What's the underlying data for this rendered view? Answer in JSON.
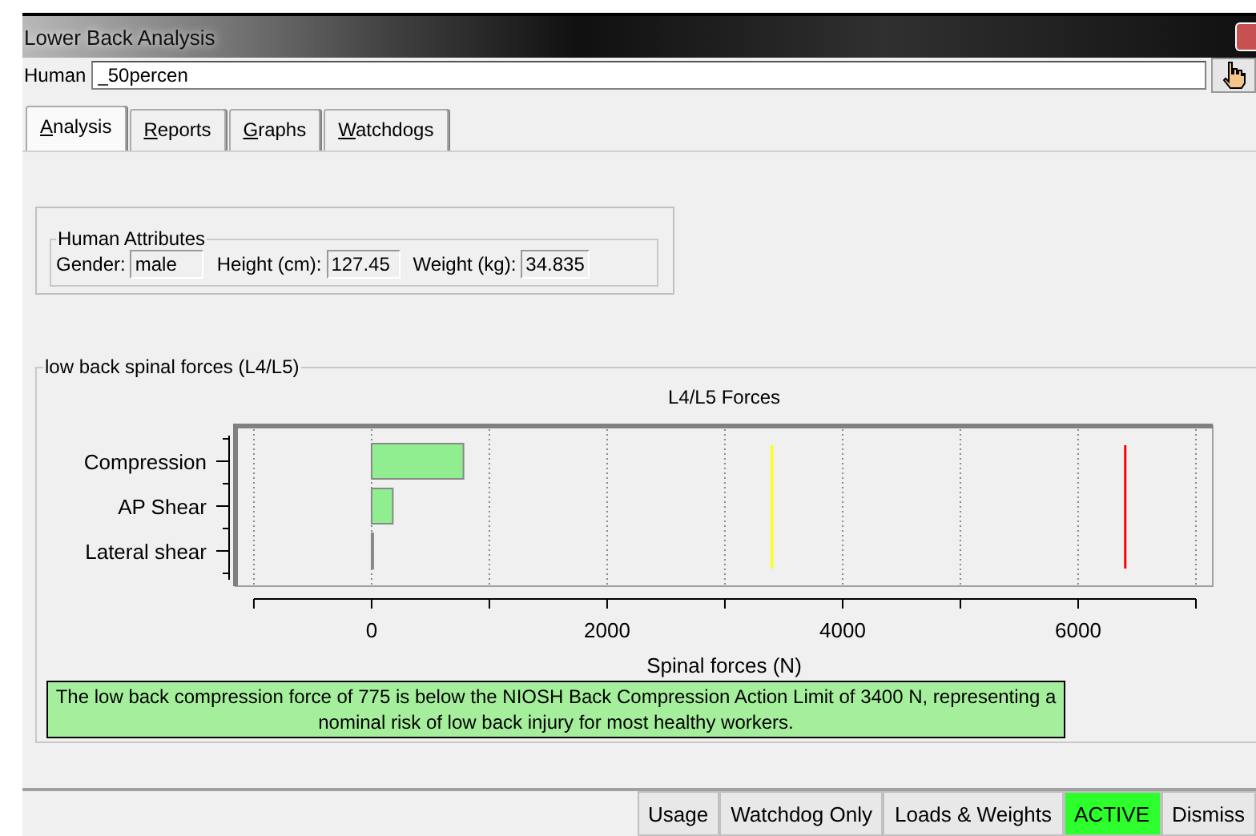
{
  "window": {
    "title": "Lower Back Analysis"
  },
  "human": {
    "label": "Human",
    "value": "_50percen"
  },
  "tabs": [
    {
      "label": "Analysis",
      "selected": true
    },
    {
      "label": "Reports",
      "selected": false
    },
    {
      "label": "Graphs",
      "selected": false
    },
    {
      "label": "Watchdogs",
      "selected": false
    }
  ],
  "human_attributes": {
    "title": "Human Attributes",
    "fields": [
      {
        "label": "Gender:",
        "value": "male"
      },
      {
        "label": "Height (cm):",
        "value": "127.45"
      },
      {
        "label": "Weight (kg):",
        "value": "34.835"
      }
    ]
  },
  "spinal_forces": {
    "title": "low back spinal forces (L4/L5)",
    "chart_data": {
      "type": "bar",
      "orientation": "horizontal",
      "title": "L4/L5 Forces",
      "xlabel": "Spinal forces (N)",
      "categories": [
        "Compression",
        "AP Shear",
        "Lateral shear"
      ],
      "series": [
        {
          "color": "#90ee90",
          "values": [
            780,
            180,
            10
          ]
        }
      ],
      "xlim": [
        -1156,
        7143
      ],
      "xticks": [
        0,
        2000,
        4000,
        6000
      ],
      "grid": true,
      "ref_lines": [
        {
          "axis": "x",
          "value": 3400,
          "color": "#ffff00"
        },
        {
          "axis": "x",
          "value": 6400,
          "color": "#ff0000"
        }
      ]
    },
    "message": "The low back compression force of 775 is below the NIOSH Back Compression Action Limit of 3400 N, representing a nominal risk of low back injury for most healthy workers."
  },
  "status_buttons": [
    {
      "label": "Usage",
      "highlighted": false
    },
    {
      "label": "Watchdog Only",
      "highlighted": false
    },
    {
      "label": "Loads & Weights",
      "highlighted": false
    },
    {
      "label": "ACTIVE",
      "highlighted": true
    },
    {
      "label": "Dismiss",
      "highlighted": false
    }
  ]
}
